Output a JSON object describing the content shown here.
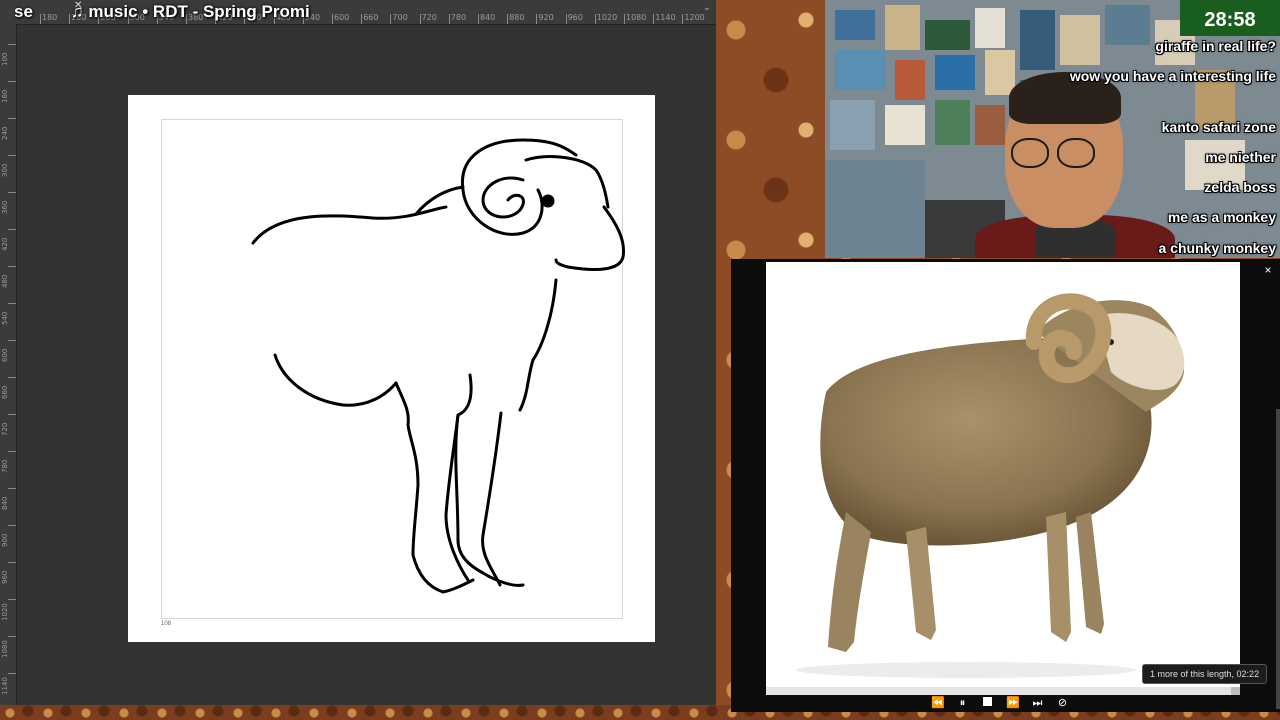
{
  "stream_title": {
    "prefix": "se",
    "text": "♫ music • RDT - Spring Promi"
  },
  "timer": "28:58",
  "chat": [
    "giraffe in real life?",
    "wow you have a interesting life",
    "kanto safari zone",
    "me niether",
    "zelda boss",
    "me as a monkey",
    "a chunky monkey"
  ],
  "media_viewer": {
    "tooltip": "1 more of this length, 02:22",
    "progress": 0.98,
    "controls": [
      "rewind-icon",
      "pause-icon",
      "stop-icon",
      "next-icon",
      "skip-end-icon",
      "hide-icon"
    ]
  },
  "ruler_top": [
    "180",
    "200",
    "260",
    "300",
    "340",
    "380",
    "420",
    "460",
    "480",
    "540",
    "600",
    "660",
    "700",
    "720",
    "780",
    "840",
    "880",
    "920",
    "960",
    "1020",
    "1080",
    "1140",
    "1200"
  ],
  "ruler_left": [
    "100",
    "160",
    "240",
    "300",
    "360",
    "420",
    "480",
    "540",
    "600",
    "660",
    "720",
    "780",
    "840",
    "900",
    "960",
    "1020",
    "1080",
    "1140"
  ],
  "canvas": {
    "corner_mark": "108"
  },
  "colors": {
    "panel_bg": "#333333",
    "timer_bg": "#1a5e1f",
    "backdrop": "#8e4c26"
  }
}
